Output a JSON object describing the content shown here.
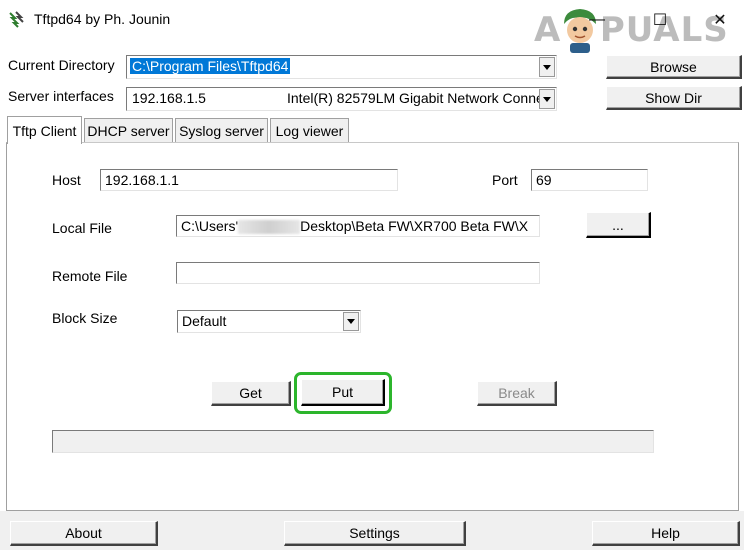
{
  "window": {
    "title": "Tftpd64 by Ph. Jounin"
  },
  "watermark": {
    "text": "APPUALS"
  },
  "controls": {
    "minimize": "—",
    "maximize": "☐",
    "close": "✕"
  },
  "top": {
    "current_directory_label": "Current Directory",
    "current_directory_value": "C:\\Program Files\\Tftpd64",
    "server_interfaces_label": "Server interfaces",
    "server_ip": "192.168.1.5",
    "server_adapter": "Intel(R) 82579LM Gigabit Network Conne",
    "browse_label": "Browse",
    "show_dir_label": "Show Dir"
  },
  "tabs": [
    {
      "label": "Tftp Client",
      "active": true
    },
    {
      "label": "DHCP server",
      "active": false
    },
    {
      "label": "Syslog server",
      "active": false
    },
    {
      "label": "Log viewer",
      "active": false
    }
  ],
  "client": {
    "host_label": "Host",
    "host_value": "192.168.1.1",
    "port_label": "Port",
    "port_value": "69",
    "local_file_label": "Local File",
    "local_file_prefix": "C:\\Users'",
    "local_file_suffix": "Desktop\\Beta FW\\XR700 Beta FW\\X",
    "browse_file_label": "...",
    "remote_file_label": "Remote File",
    "remote_file_value": "",
    "block_size_label": "Block Size",
    "block_size_value": "Default",
    "get_label": "Get",
    "put_label": "Put",
    "break_label": "Break"
  },
  "footer": {
    "about_label": "About",
    "settings_label": "Settings",
    "help_label": "Help"
  },
  "colors": {
    "put_highlight": "#2cb52c",
    "selection": "#0078d7"
  }
}
